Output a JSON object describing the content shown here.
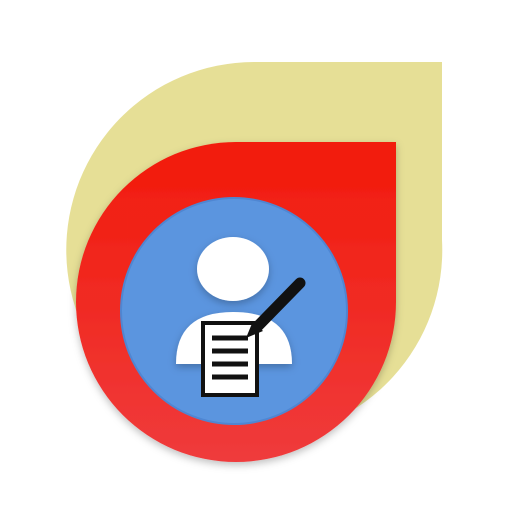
{
  "icon": {
    "name": "user-document-edit-icon",
    "colors": {
      "back_petal": "#e6df96",
      "front_petal_top": "#f21a0a",
      "front_petal_bottom": "#ef3b3c",
      "disc": "#5b95df",
      "disc_edge": "#4f86d2",
      "person": "#ffffff",
      "document": "#ffffff",
      "document_lines": "#111111",
      "pen": "#111111"
    }
  }
}
